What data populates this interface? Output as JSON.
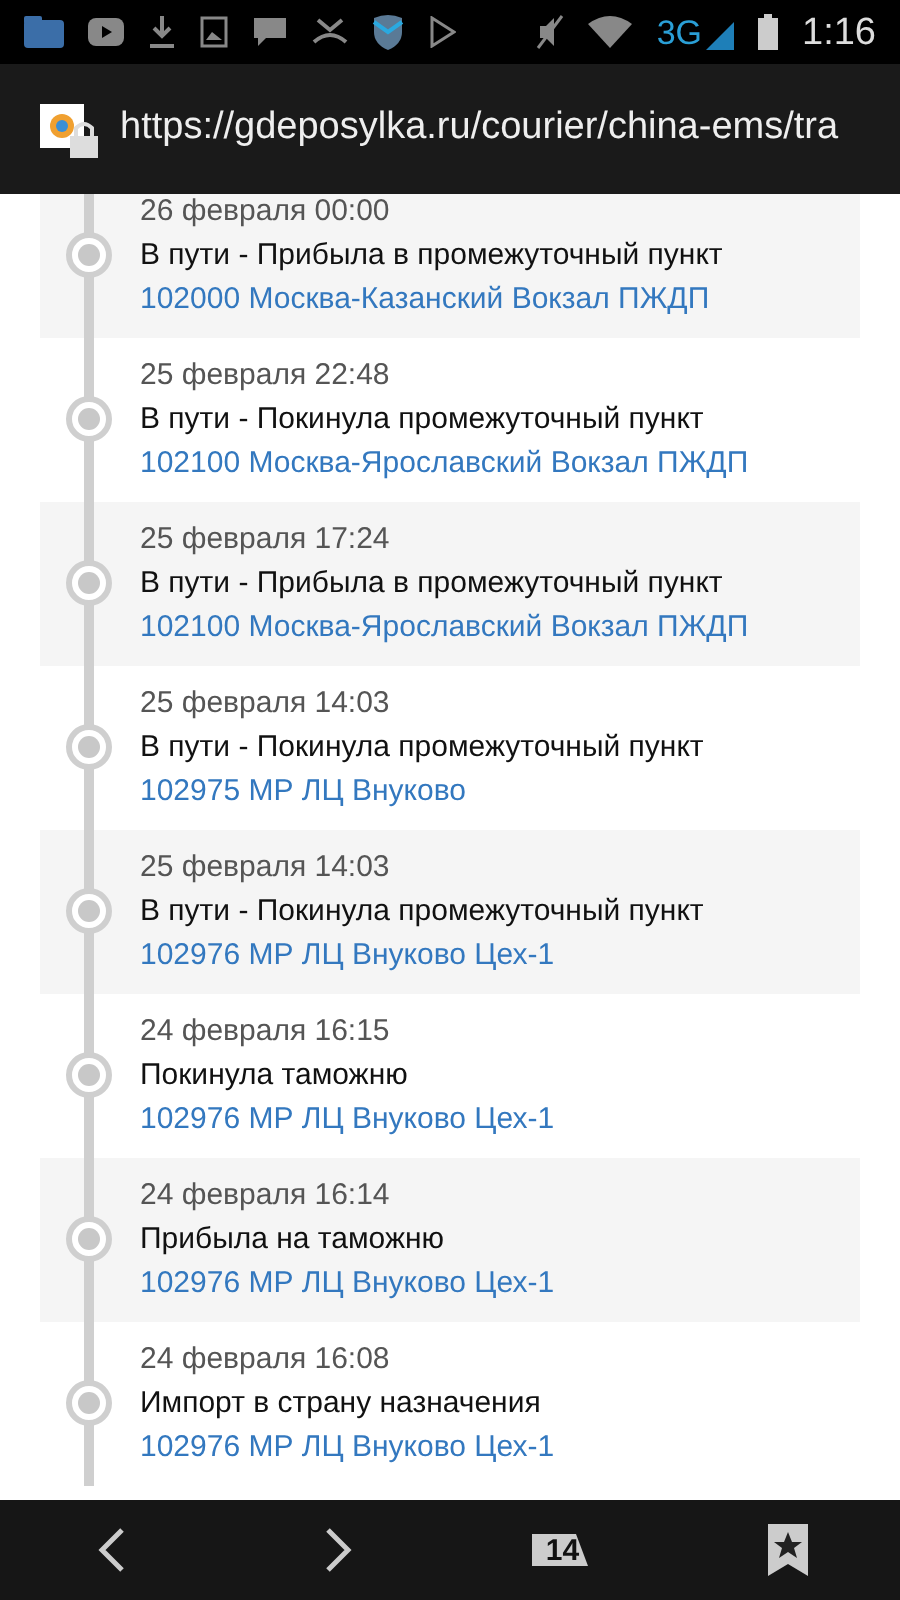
{
  "status_bar": {
    "network": "3G",
    "time": "1:16"
  },
  "address_bar": {
    "url": "https://gdeposylka.ru/courier/china-ems/tra"
  },
  "events": [
    {
      "date": "26 февраля 00:00",
      "status": "В пути - Прибыла в промежуточный пункт",
      "location": "102000 Москва-Казанский Вокзал ПЖДП"
    },
    {
      "date": "25 февраля 22:48",
      "status": "В пути - Покинула промежуточный пункт",
      "location": "102100 Москва-Ярославский Вокзал ПЖДП"
    },
    {
      "date": "25 февраля 17:24",
      "status": "В пути - Прибыла в промежуточный пункт",
      "location": "102100 Москва-Ярославский Вокзал ПЖДП"
    },
    {
      "date": "25 февраля 14:03",
      "status": "В пути - Покинула промежуточный пункт",
      "location": "102975 МР ЛЦ Внуково"
    },
    {
      "date": "25 февраля 14:03",
      "status": "В пути - Покинула промежуточный пункт",
      "location": "102976 МР ЛЦ Внуково Цех-1"
    },
    {
      "date": "24 февраля 16:15",
      "status": "Покинула таможню",
      "location": "102976 МР ЛЦ Внуково Цех-1"
    },
    {
      "date": "24 февраля 16:14",
      "status": "Прибыла на таможню",
      "location": "102976 МР ЛЦ Внуково Цех-1"
    },
    {
      "date": "24 февраля 16:08",
      "status": "Импорт в страну назначения",
      "location": "102976 МР ЛЦ Внуково Цех-1"
    }
  ],
  "bottom_bar": {
    "tab_count": "14"
  }
}
